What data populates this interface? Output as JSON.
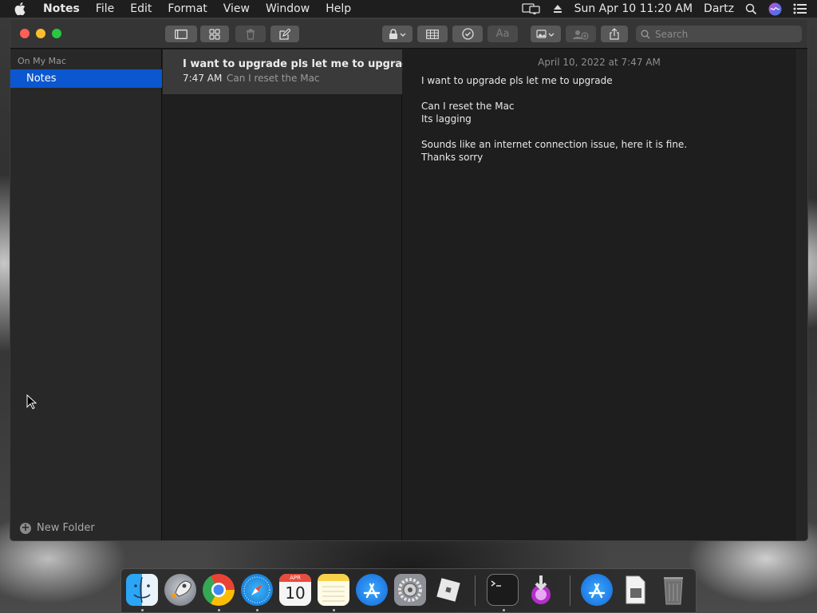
{
  "menubar": {
    "app_name": "Notes",
    "items": [
      "File",
      "Edit",
      "Format",
      "View",
      "Window",
      "Help"
    ],
    "date_time": "Sun Apr 10  11:20 AM",
    "user": "Dartz"
  },
  "window": {
    "toolbar": {
      "search_placeholder": "Search",
      "font_button": "Aa"
    },
    "sidebar": {
      "section": "On My Mac",
      "selected_folder": "Notes",
      "new_folder": "New Folder"
    },
    "note_list": [
      {
        "title": "I want to upgrade pls let me to upgrade",
        "time": "7:47 AM",
        "preview": "Can I reset the Mac"
      }
    ],
    "editor": {
      "date": "April 10, 2022 at 7:47 AM",
      "lines": {
        "l1": "I want to upgrade pls let me to upgrade",
        "l2": "Can I reset the Mac",
        "l3": "Its lagging",
        "l4": "Sounds like an internet connection issue, here it is fine.",
        "l5": "Thanks sorry"
      }
    }
  },
  "dock": {
    "calendar_month": "APR",
    "calendar_day": "10",
    "icons": [
      "finder-icon",
      "launchpad-icon",
      "chrome-icon",
      "safari-icon",
      "calendar-icon",
      "notes-icon",
      "app-store-icon",
      "system-preferences-icon",
      "roblox-icon",
      "terminal-icon",
      "installer-icon",
      "app-store-folder-icon",
      "preview-icon",
      "trash-icon"
    ]
  },
  "colors": {
    "accent": "#0b57d0",
    "close": "#ff5f57",
    "minimize": "#febc2e",
    "maximize": "#28c840"
  }
}
